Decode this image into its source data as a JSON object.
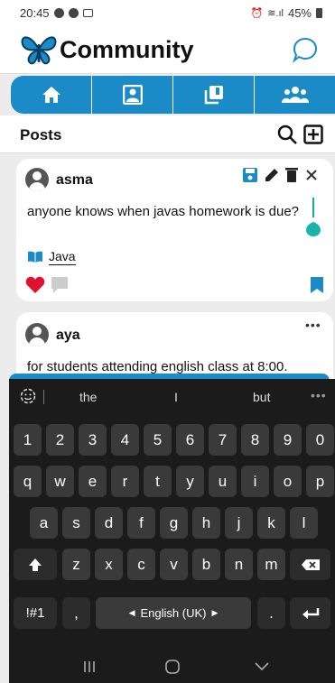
{
  "status": {
    "time": "20:45",
    "battery": "45%"
  },
  "header": {
    "title": "Community"
  },
  "tabs": [
    {
      "icon": "home-icon"
    },
    {
      "icon": "contact-card-icon"
    },
    {
      "icon": "library-icon"
    },
    {
      "icon": "group-icon"
    }
  ],
  "posts_bar": {
    "title": "Posts"
  },
  "posts": [
    {
      "user": "asma",
      "text": "anyone knows when javas homework is due?",
      "tag": "Java"
    },
    {
      "user": "aya",
      "text": "for students attending english class at 8:00."
    }
  ],
  "keyboard": {
    "suggestions": [
      "the",
      "I",
      "but"
    ],
    "more": "•••",
    "row_numbers": [
      "1",
      "2",
      "3",
      "4",
      "5",
      "6",
      "7",
      "8",
      "9",
      "0"
    ],
    "row1": [
      "q",
      "w",
      "e",
      "r",
      "t",
      "y",
      "u",
      "i",
      "o",
      "p"
    ],
    "row2": [
      "a",
      "s",
      "d",
      "f",
      "g",
      "h",
      "j",
      "k",
      "l"
    ],
    "row3": [
      "z",
      "x",
      "c",
      "v",
      "b",
      "n",
      "m"
    ],
    "symbols_key": "!#1",
    "comma_key": ",",
    "space_label": "English (UK)",
    "period_key": "."
  },
  "colors": {
    "accent": "#1a8bc7",
    "like": "#e0102e",
    "bookmark": "#1a8bc7"
  }
}
